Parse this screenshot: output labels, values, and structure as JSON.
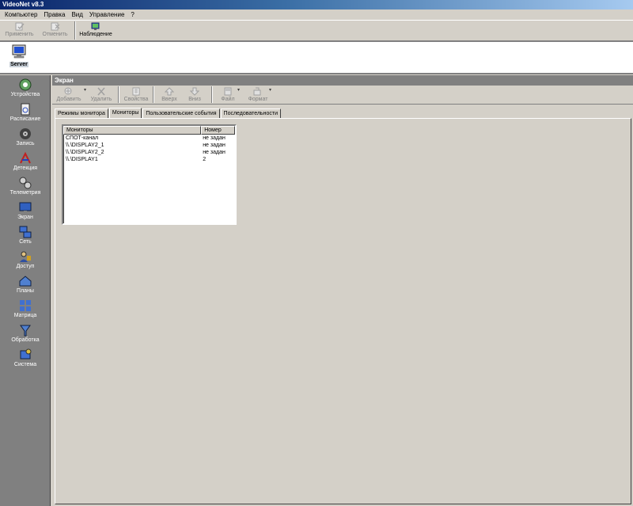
{
  "window": {
    "title": "VideoNet v8.3"
  },
  "menu": [
    "Компьютер",
    "Правка",
    "Вид",
    "Управление",
    "?"
  ],
  "toolbar": [
    {
      "label": "Применить",
      "icon": "apply-icon",
      "enabled": false
    },
    {
      "label": "Отменить",
      "icon": "undo-icon",
      "enabled": false
    },
    {
      "label": "Наблюдение",
      "icon": "monitor-view-icon",
      "enabled": true
    }
  ],
  "server": {
    "label": "Server",
    "icon": "computer-icon"
  },
  "sidebar": [
    {
      "label": "Устройства",
      "icon": "devices-icon"
    },
    {
      "label": "Расписание",
      "icon": "schedule-icon"
    },
    {
      "label": "Запись",
      "icon": "record-icon"
    },
    {
      "label": "Детекция",
      "icon": "detection-icon"
    },
    {
      "label": "Телеметрия",
      "icon": "telemetry-icon"
    },
    {
      "label": "Экран",
      "icon": "screen-icon"
    },
    {
      "label": "Сеть",
      "icon": "network-icon"
    },
    {
      "label": "Доступ",
      "icon": "access-icon"
    },
    {
      "label": "Планы",
      "icon": "plans-icon"
    },
    {
      "label": "Матрица",
      "icon": "matrix-icon"
    },
    {
      "label": "Обработка",
      "icon": "processing-icon"
    },
    {
      "label": "Система",
      "icon": "system-icon"
    }
  ],
  "panel": {
    "title": "Экран",
    "toolbar": [
      {
        "label": "Добавить",
        "icon": "add-icon",
        "dropdown": true
      },
      {
        "label": "Удалить",
        "icon": "delete-icon",
        "dropdown": false
      },
      {
        "label": "Свойства",
        "icon": "properties-icon",
        "dropdown": false
      },
      {
        "label": "Вверх",
        "icon": "up-icon",
        "dropdown": false
      },
      {
        "label": "Вниз",
        "icon": "down-icon",
        "dropdown": false
      },
      {
        "label": "Файл",
        "icon": "file-icon",
        "dropdown": true
      },
      {
        "label": "Формат",
        "icon": "format-icon",
        "dropdown": true
      }
    ],
    "tabs": [
      "Режимы монитора",
      "Мониторы",
      "Пользовательские события",
      "Последовательности"
    ],
    "active_tab": "Мониторы",
    "table": {
      "headers": [
        "Мониторы",
        "Номер"
      ],
      "rows": [
        [
          "СПОТ-канал",
          "не задан"
        ],
        [
          "\\\\.\\DISPLAY2_1",
          "не задан"
        ],
        [
          "\\\\.\\DISPLAY2_2",
          "не задан"
        ],
        [
          "\\\\.\\DISPLAY1",
          "2"
        ]
      ]
    }
  }
}
